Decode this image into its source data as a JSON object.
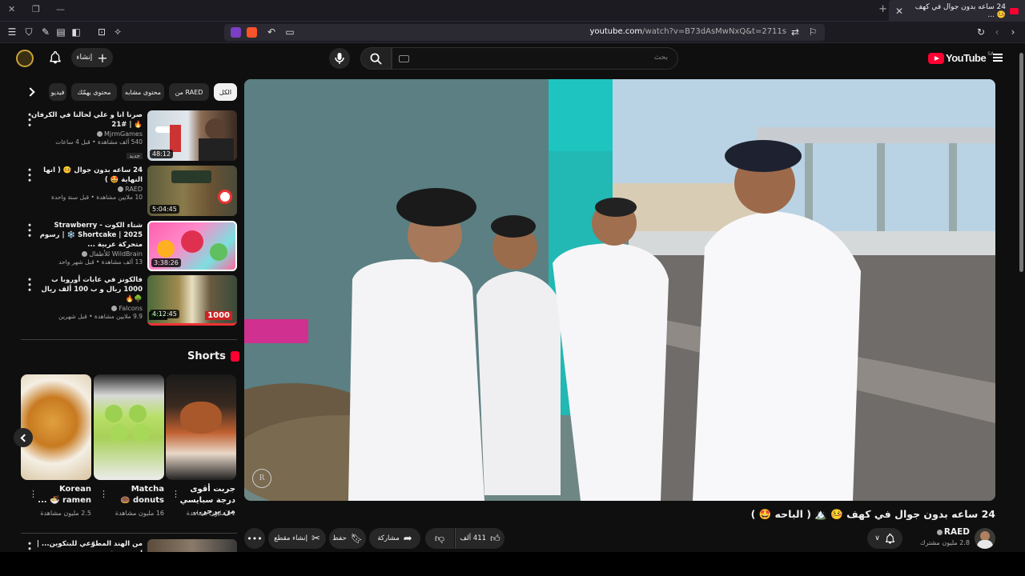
{
  "browser": {
    "tab_title": "24 ساعه بدون جوال في كهف 🤒 ...",
    "url_host": "youtube.com",
    "url_path": "/watch?v=B73dAsMwNxQ&t=2711s"
  },
  "header": {
    "create_label": "إنشاء",
    "search_placeholder": "بحث",
    "logo_text": "YouTube",
    "logo_region": "SA"
  },
  "chips": [
    "الكل",
    "من RAED",
    "محتوى مشابه",
    "محتوى يهمّك",
    "فيديو"
  ],
  "recommendations": [
    {
      "title": "صرنا انا و علي لحالنا في الكرفان 🔥 | #21",
      "channel": "MjrmGames",
      "meta": "540 ألف مشاهدة • قبل 4 ساعات",
      "badge": "جديد",
      "duration": "48:12"
    },
    {
      "title": "24 ساعه بدون جوال 🤒 ( انها النهاية 🤩 )",
      "channel": "RAED",
      "meta": "10 ملايين مشاهدة • قبل سنة واحدة",
      "badge": "",
      "duration": "5:04:45"
    },
    {
      "title": "شتاء الكوت - Strawberry Shortcake | 2025 ❄️ | رسوم متحركة عربية ...",
      "channel": "WildBrain للأطفال",
      "meta": "13 ألف مشاهدة • قبل شهر واحد",
      "badge": "",
      "duration": "3:38:26"
    },
    {
      "title": "فالكونز في عابات أوروبا ب 1000 ريال و ب 100 ألف ريال 🌳🔥",
      "channel": "Falcons",
      "meta": "9.9 ملايين مشاهدة • قبل شهرين",
      "badge": "",
      "duration": "4:12:45"
    }
  ],
  "shorts": {
    "heading": "Shorts",
    "items": [
      {
        "title": "Korean ramen 🍜 ...",
        "views": "2.5 مليون مشاهدة"
      },
      {
        "title": "Matcha donuts 🍩",
        "views": "16 مليون مشاهدة"
      },
      {
        "title": "جربت أقوى درجة سبايسي من برجر...",
        "views": "11 مليون مشاهدة"
      }
    ]
  },
  "last_rec": {
    "title": "من الهند المطوّعي للبتكوين... | ابو سعد في"
  },
  "video": {
    "title": "24 ساعه بدون جوال في كهف 🤒 🏔️ ( الباحه 🤩 )",
    "channel": "RAED",
    "subscribers": "2.8 مليون مشترك",
    "likes": "411 ألف",
    "share_label": "مشاركة",
    "save_label": "حفظ",
    "clip_label": "إنشاء مقطع",
    "watermark": "R"
  }
}
